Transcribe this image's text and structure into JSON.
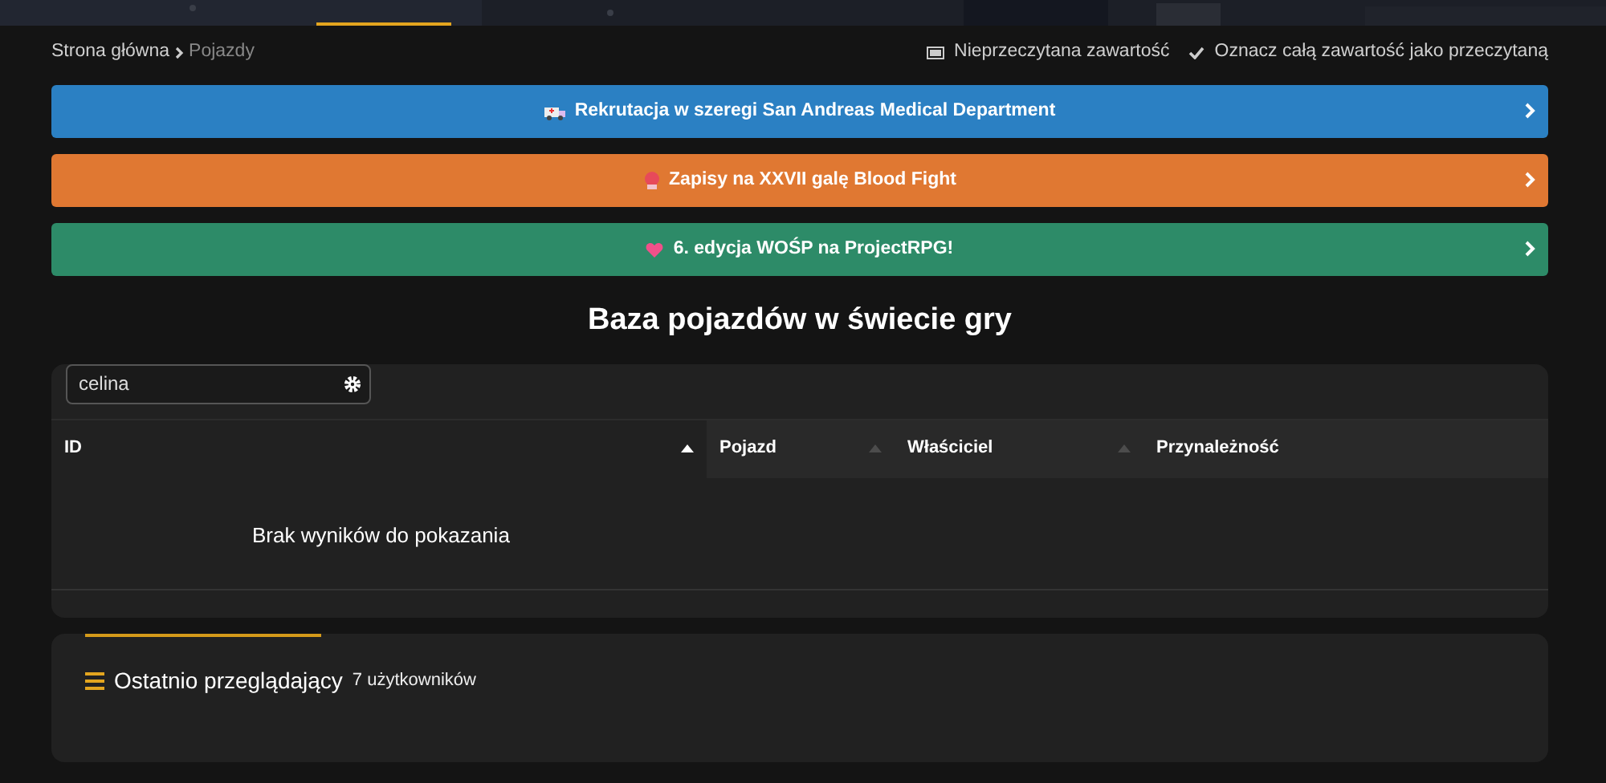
{
  "breadcrumb": [
    {
      "label": "Strona główna",
      "current": false
    },
    {
      "label": "Pojazdy",
      "current": true
    }
  ],
  "top_actions": [
    {
      "kind": "unread",
      "label": "Nieprzeczytana zawartość"
    },
    {
      "kind": "mark",
      "label": "Oznacz całą zawartość jako przeczytaną"
    }
  ],
  "notices": [
    {
      "kind": "ambulance",
      "text": "Rekrutacja w szeregi San Andreas Medical Department",
      "color": "#2b80c3"
    },
    {
      "kind": "glove",
      "text": "Zapisy na XXVII galę Blood Fight",
      "color": "#e07832"
    },
    {
      "kind": "heart",
      "text": "6. edycja WOŚP na ProjectRPG!",
      "color": "#2d8b68"
    }
  ],
  "page_title": "Baza pojazdów w świecie gry",
  "search": {
    "value": "celina"
  },
  "table": {
    "columns": [
      {
        "label": "ID",
        "sorted": true
      },
      {
        "label": "Pojazd",
        "sorted": false
      },
      {
        "label": "Właściciel",
        "sorted": false
      },
      {
        "label": "Przynależność"
      }
    ],
    "empty_message": "Brak wyników do pokazania"
  },
  "recent_viewers": {
    "title": "Ostatnio przeglądający",
    "count": "7 użytkowników"
  }
}
